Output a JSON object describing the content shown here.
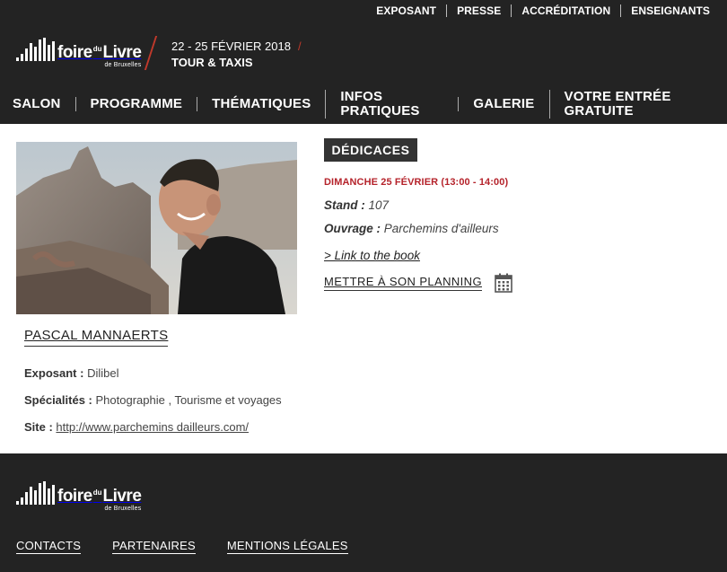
{
  "top_nav": [
    "EXPOSANT",
    "PRESSE",
    "ACCRÉDITATION",
    "ENSEIGNANTS"
  ],
  "logo": {
    "word1": "foire",
    "du": "du",
    "word2": "Livre",
    "sub": "de Bruxelles"
  },
  "event": {
    "dates": "22 - 25 FÉVRIER 2018",
    "slash": "/",
    "venue": "TOUR & TAXIS"
  },
  "main_nav": [
    "SALON",
    "PROGRAMME",
    "THÉMATIQUES",
    "INFOS PRATIQUES",
    "GALERIE",
    "VOTRE ENTRÉE GRATUITE"
  ],
  "author": {
    "name": "PASCAL MANNAERTS",
    "exposant_label": "Exposant :",
    "exposant_value": "Dilibel",
    "specialites_label": "Spécialités :",
    "specialites_value": "Photographie , Tourisme et voyages",
    "site_label": "Site :",
    "site_value": "http://www.parchemins dailleurs.com/"
  },
  "signing": {
    "tab": "DÉDICACES",
    "datetime": "DIMANCHE 25 FÉVRIER (13:00 - 14:00)",
    "stand_label": "Stand :",
    "stand_value": "107",
    "ouvrage_label": "Ouvrage :",
    "ouvrage_value": "Parchemins d'ailleurs",
    "book_link": "> Link to the book",
    "planning": "METTRE À SON PLANNING",
    "calendar_icon": "calendar-icon"
  },
  "footer_nav": [
    "CONTACTS",
    "PARTENAIRES",
    "MENTIONS LÉGALES"
  ],
  "colors": {
    "dark": "#232323",
    "accent_red": "#b5232b"
  }
}
